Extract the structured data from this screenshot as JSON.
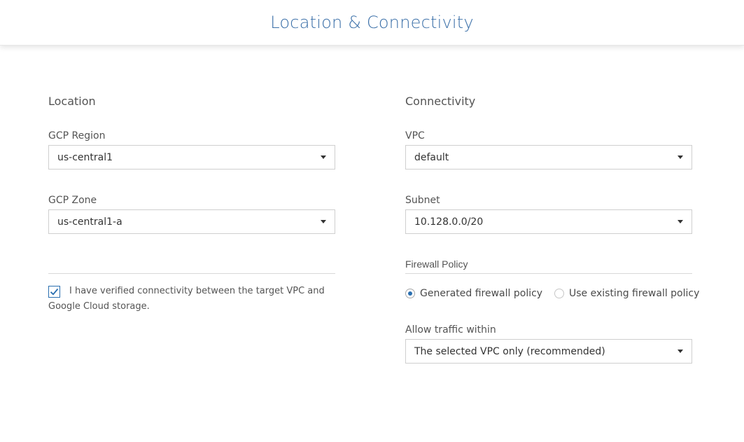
{
  "header": {
    "title": "Location & Connectivity"
  },
  "location": {
    "title": "Location",
    "region": {
      "label": "GCP Region",
      "value": "us-central1"
    },
    "zone": {
      "label": "GCP Zone",
      "value": "us-central1-a"
    },
    "verify": {
      "checked": true,
      "text": "I have verified connectivity between the target VPC and Google Cloud storage."
    }
  },
  "connectivity": {
    "title": "Connectivity",
    "vpc": {
      "label": "VPC",
      "value": "default"
    },
    "subnet": {
      "label": "Subnet",
      "value": "10.128.0.0/20"
    },
    "firewall": {
      "label": "Firewall Policy",
      "options": [
        {
          "label": "Generated firewall policy",
          "selected": true
        },
        {
          "label": "Use existing firewall policy",
          "selected": false
        }
      ]
    },
    "traffic": {
      "label": "Allow traffic within",
      "value": "The selected VPC only (recommended)"
    }
  },
  "colors": {
    "accent": "#2a6fb0",
    "title": "#3a6fa8",
    "border": "#cfcfcf"
  }
}
